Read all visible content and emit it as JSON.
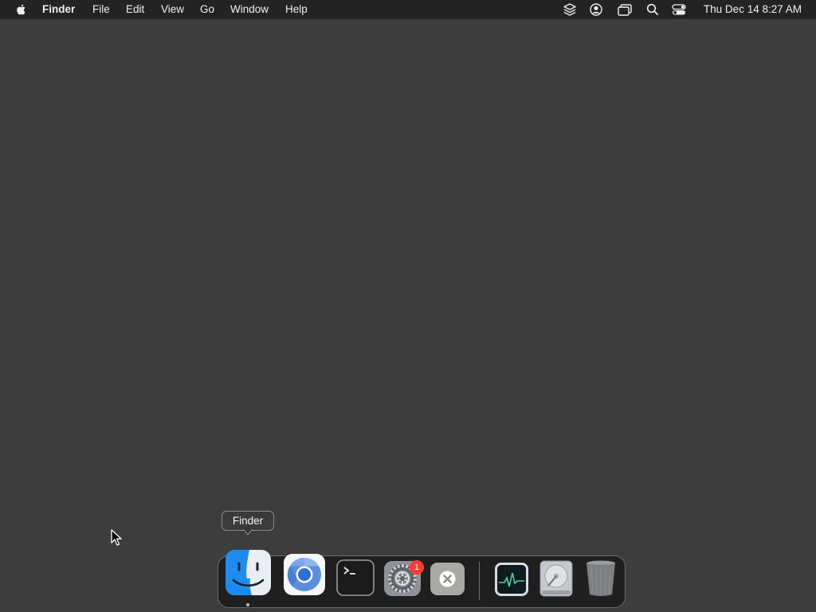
{
  "menubar": {
    "app_name": "Finder",
    "menus": [
      "File",
      "Edit",
      "View",
      "Go",
      "Window",
      "Help"
    ],
    "status_icons": [
      "layers-icon",
      "user-account-icon",
      "screen-mirroring-icon",
      "spotlight-search-icon",
      "control-center-icon"
    ],
    "clock": "Thu Dec 14  8:27 AM"
  },
  "tooltip": {
    "text": "Finder"
  },
  "dock": {
    "apps": [
      {
        "name": "Finder",
        "icon": "finder-icon",
        "running": true
      },
      {
        "name": "Chromium",
        "icon": "chromium-icon"
      },
      {
        "name": "Terminal",
        "icon": "terminal-icon"
      },
      {
        "name": "System Settings",
        "icon": "system-settings-icon",
        "badge": "1"
      },
      {
        "name": "Close",
        "icon": "close-x-icon"
      },
      {
        "name": "Activity Monitor",
        "icon": "activity-monitor-icon"
      },
      {
        "name": "Disk Utility",
        "icon": "disk-icon"
      },
      {
        "name": "Trash",
        "icon": "trash-icon"
      }
    ]
  },
  "colors": {
    "desktop": "#3d3d3d",
    "menubar": "#232323",
    "badge": "#ff3b30",
    "finder_blue": "#1d8cf0"
  }
}
